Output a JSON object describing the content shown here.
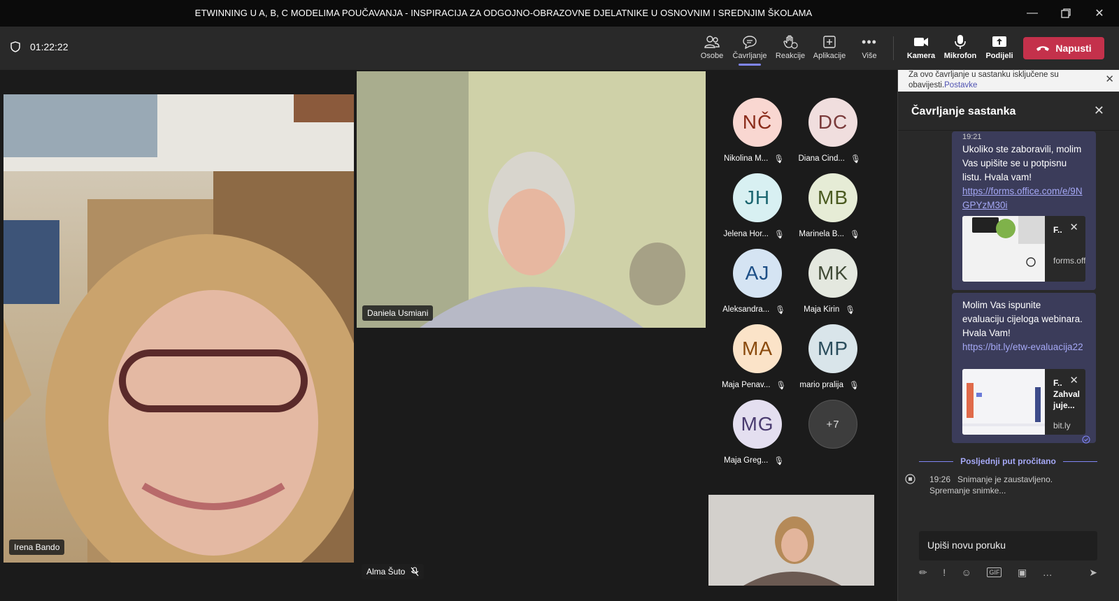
{
  "window": {
    "title": "ETWINNING U A, B, C MODELIMA POUČAVANJA - INSPIRACIJA ZA ODGOJNO-OBRAZOVNE DJELATNIKE U OSNOVNIM I SREDNJIM ŠKOLAMA"
  },
  "toolbar": {
    "timer": "01:22:22",
    "people": "Osobe",
    "chat": "Čavrljanje",
    "reactions": "Reakcije",
    "apps": "Aplikacije",
    "more": "Više",
    "camera": "Kamera",
    "mic": "Mikrofon",
    "share": "Podijeli",
    "leave": "Napusti"
  },
  "stage": {
    "tiles": [
      {
        "name": "Irena Bando"
      },
      {
        "name": "Daniela Usmiani"
      },
      {
        "name": "Alma Šuto"
      }
    ],
    "avatars": [
      {
        "initials": "NČ",
        "name": "Nikolina M...",
        "bg": "#f9d7d1",
        "fg": "#8a2c1a"
      },
      {
        "initials": "DC",
        "name": "Diana Cind...",
        "bg": "#f0dede",
        "fg": "#7a3b3b"
      },
      {
        "initials": "JH",
        "name": "Jelena Hor...",
        "bg": "#d8f0f2",
        "fg": "#1b6670"
      },
      {
        "initials": "MB",
        "name": "Marinela B...",
        "bg": "#e6ecd6",
        "fg": "#4a5a20"
      },
      {
        "initials": "AJ",
        "name": "Aleksandra...",
        "bg": "#d5e4f3",
        "fg": "#1d4f86"
      },
      {
        "initials": "MK",
        "name": "Maja Kirin",
        "bg": "#e4e8df",
        "fg": "#404a36"
      },
      {
        "initials": "MA",
        "name": "Maja Penav...",
        "bg": "#fbe3c8",
        "fg": "#8a4a0c"
      },
      {
        "initials": "MP",
        "name": "mario pralija",
        "bg": "#d9e5ea",
        "fg": "#2b4d5c"
      },
      {
        "initials": "MG",
        "name": "Maja Greg...",
        "bg": "#e4dff0",
        "fg": "#4a3b70"
      }
    ],
    "overflow": "+7"
  },
  "chat": {
    "banner_text": "Za ovo čavrljanje u sastanku isključene su obavijesti.",
    "banner_link": "Postavke",
    "title": "Čavrljanje sastanka",
    "msg1": {
      "time": "19:21",
      "text": "Ukoliko ste zaboravili, molim Vas upišite se u potpisnu listu. Hvala vam!",
      "link": "https://forms.office.com/e/9NGPYzM30i",
      "card_title": "F..",
      "card_domain": "forms.offic..."
    },
    "msg2": {
      "text": "Molim Vas ispunite evaluaciju cijeloga webinara. Hvala Vam!",
      "link": "https://bit.ly/etw-evaluacija22",
      "card_title": "F..",
      "card_desc": "Zahval juje...",
      "card_domain": "bit.ly"
    },
    "last_read": "Posljednji put pročitano",
    "system": {
      "time": "19:26",
      "text": "Snimanje je zaustavljeno. Spremanje snimke..."
    },
    "compose_placeholder": "Upiši novu poruku"
  }
}
